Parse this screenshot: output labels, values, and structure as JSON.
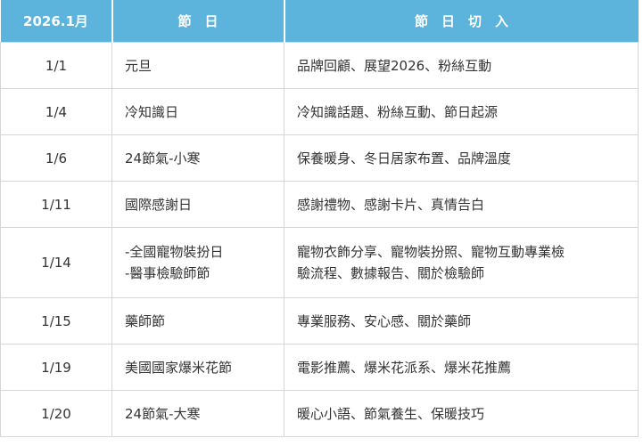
{
  "header": {
    "month": "2026.1月",
    "festival": "節　日",
    "angle": "節　日　切　入"
  },
  "rows": [
    {
      "date": "1/1",
      "festival": [
        "元旦"
      ],
      "angle": [
        "品牌回顧、展望2026、粉絲互動"
      ]
    },
    {
      "date": "1/4",
      "festival": [
        "冷知識日"
      ],
      "angle": [
        "冷知識話題、粉絲互動、節日起源"
      ]
    },
    {
      "date": "1/6",
      "festival": [
        "24節氣-小寒"
      ],
      "angle": [
        "保養暖身、冬日居家布置、品牌溫度"
      ]
    },
    {
      "date": "1/11",
      "festival": [
        "國際感謝日"
      ],
      "angle": [
        "感謝禮物、感謝卡片、真情告白"
      ]
    },
    {
      "date": "1/14",
      "festival": [
        "-全國寵物裝扮日",
        "-醫事檢驗師節"
      ],
      "angle": [
        "寵物衣飾分享、寵物裝扮照、寵物互動專業檢",
        "驗流程、數據報告、關於檢驗師"
      ]
    },
    {
      "date": "1/15",
      "festival": [
        "藥師節"
      ],
      "angle": [
        "專業服務、安心感、關於藥師"
      ]
    },
    {
      "date": "1/19",
      "festival": [
        "美國國家爆米花節"
      ],
      "angle": [
        "電影推薦、爆米花派系、爆米花推薦"
      ]
    },
    {
      "date": "1/20",
      "festival": [
        "24節氣-大寒"
      ],
      "angle": [
        "暖心小語、節氣養生、保暖技巧"
      ]
    }
  ],
  "colors": {
    "header_bg": "#5cb3dc",
    "header_text": "#ffffff",
    "cell_text": "#333333",
    "border": "#d7d7d7"
  }
}
